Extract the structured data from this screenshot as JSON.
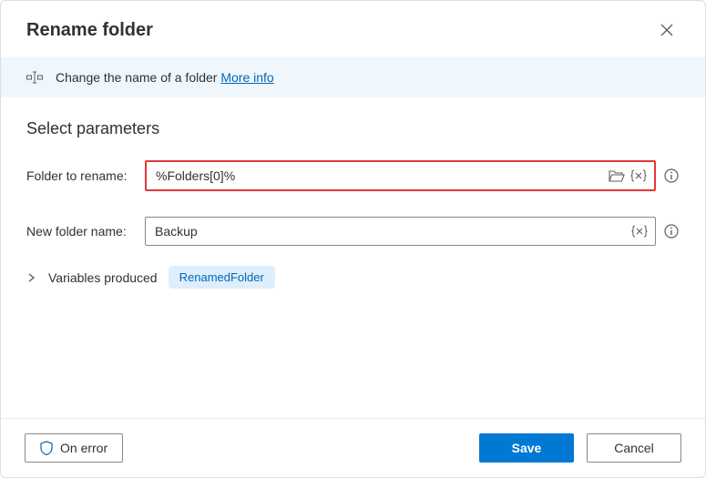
{
  "header": {
    "title": "Rename folder"
  },
  "banner": {
    "text": "Change the name of a folder",
    "more_info": "More info"
  },
  "section": {
    "title": "Select parameters"
  },
  "fields": {
    "folder_to_rename": {
      "label": "Folder to rename:",
      "value": "%Folders[0]%"
    },
    "new_folder_name": {
      "label": "New folder name:",
      "value": "Backup"
    }
  },
  "variables": {
    "label": "Variables produced",
    "chip": "RenamedFolder"
  },
  "footer": {
    "on_error": "On error",
    "save": "Save",
    "cancel": "Cancel"
  }
}
